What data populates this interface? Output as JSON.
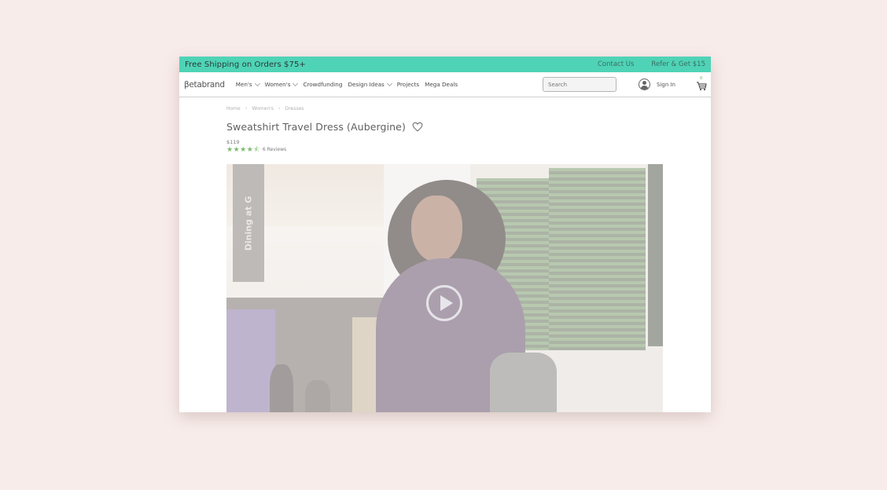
{
  "promo": {
    "message": "Free Shipping on Orders $75+",
    "links": [
      "Contact Us",
      "Refer & Get $15"
    ]
  },
  "nav": {
    "logo": "βetabrand",
    "items": [
      {
        "label": "Men's",
        "has_dropdown": true
      },
      {
        "label": "Women's",
        "has_dropdown": true
      },
      {
        "label": "Crowdfunding",
        "has_dropdown": false
      },
      {
        "label": "Design Ideas",
        "has_dropdown": true
      },
      {
        "label": "Projects",
        "has_dropdown": false
      },
      {
        "label": "Mega Deals",
        "has_dropdown": false
      }
    ],
    "search_placeholder": "Search",
    "sign_in": "Sign In",
    "cart_count": "0",
    "icons": {
      "user": "user-icon",
      "cart": "cart-icon",
      "search": "search-field"
    }
  },
  "breadcrumb": [
    "Home",
    "Women's",
    "Dresses"
  ],
  "product": {
    "title": "Sweatshirt Travel Dress (Aubergine)",
    "price": "$119",
    "rating": 4.5,
    "rating_max": 5,
    "reviews": "6 Reviews",
    "video_sign_text": "Dining at G"
  },
  "colors": {
    "promo_bg": "#4fd3b6",
    "star": "#57a845",
    "page_bg": "#f8ecea"
  }
}
